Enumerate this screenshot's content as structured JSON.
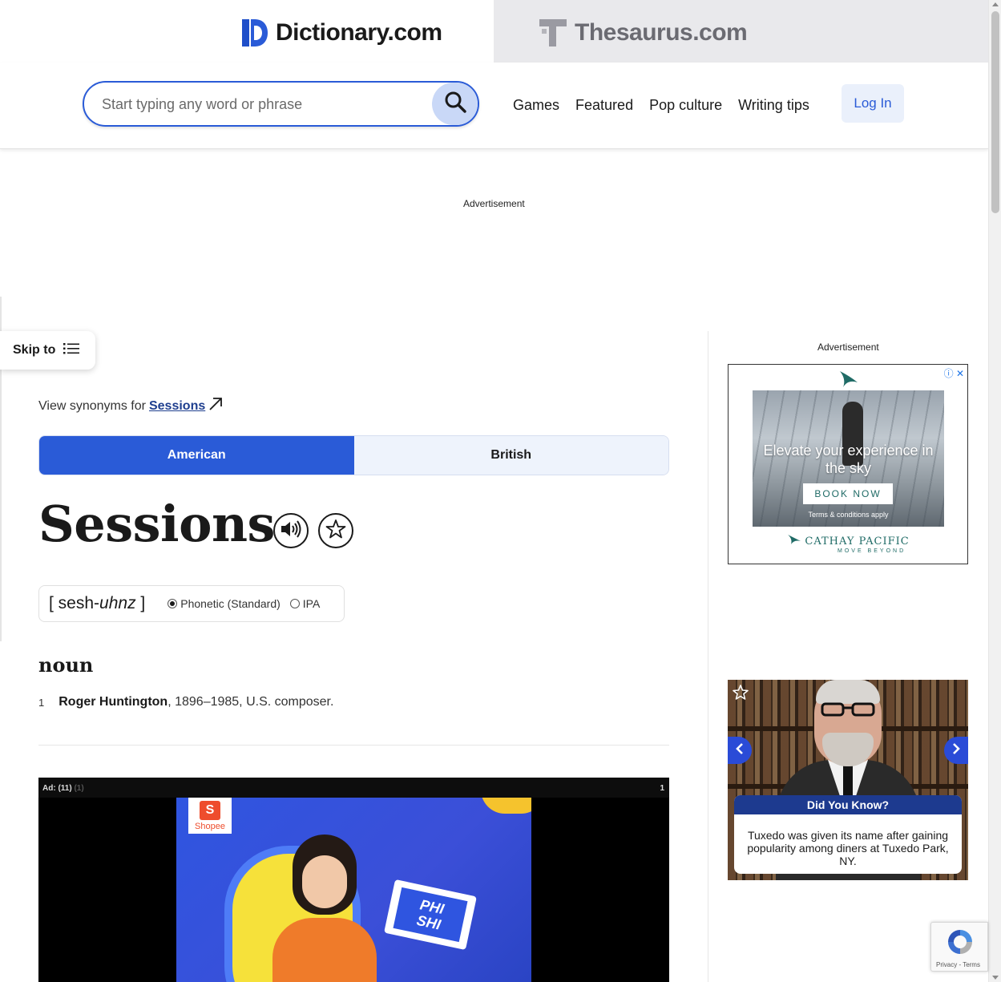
{
  "tabs": {
    "dictionary": "Dictionary.com",
    "thesaurus": "Thesaurus.com"
  },
  "search": {
    "placeholder": "Start typing any word or phrase",
    "value": ""
  },
  "nav": [
    "Games",
    "Featured",
    "Pop culture",
    "Writing tips"
  ],
  "login_label": "Log In",
  "ads": {
    "top_label": "Advertisement",
    "side_label": "Advertisement",
    "cathay": {
      "headline": "Elevate your experience in the sky",
      "button": "BOOK NOW",
      "terms": "Terms & conditions apply",
      "brand": "CATHAY PACIFIC",
      "tagline": "MOVE BEYOND"
    },
    "did_you_know": {
      "title": "Did You Know?",
      "text": "Tuxedo was given its name after gaining popularity among diners at Tuxedo Park, NY."
    },
    "video": {
      "label": "Ad: (11)",
      "label_faded": "(1)",
      "counter": "1",
      "brand": "Shopee",
      "box_line1": "PHI",
      "box_line2": "SHI"
    }
  },
  "skip_to": "Skip to",
  "synonyms": {
    "prefix": "View synonyms for",
    "word": "Sessions"
  },
  "dialect": {
    "american": "American",
    "british": "British",
    "active": "American"
  },
  "entry": {
    "headword": "Sessions",
    "pron_open": "[ ",
    "pron_main": "sesh-",
    "pron_italic": "uhnz",
    "pron_close": " ]",
    "pron_options": {
      "phonetic": "Phonetic (Standard)",
      "ipa": "IPA",
      "selected": "phonetic"
    },
    "part_of_speech": "noun",
    "definitions": [
      {
        "number": "1",
        "name": "Roger Huntington",
        "rest": ", 1896–1985, U.S. composer."
      }
    ]
  },
  "recaptcha": {
    "links": "Privacy - Terms"
  },
  "colors": {
    "accent_blue": "#2a5bd7",
    "thesaurus_tab_bg": "#e9e9ec",
    "login_bg": "#eaf0fb"
  }
}
